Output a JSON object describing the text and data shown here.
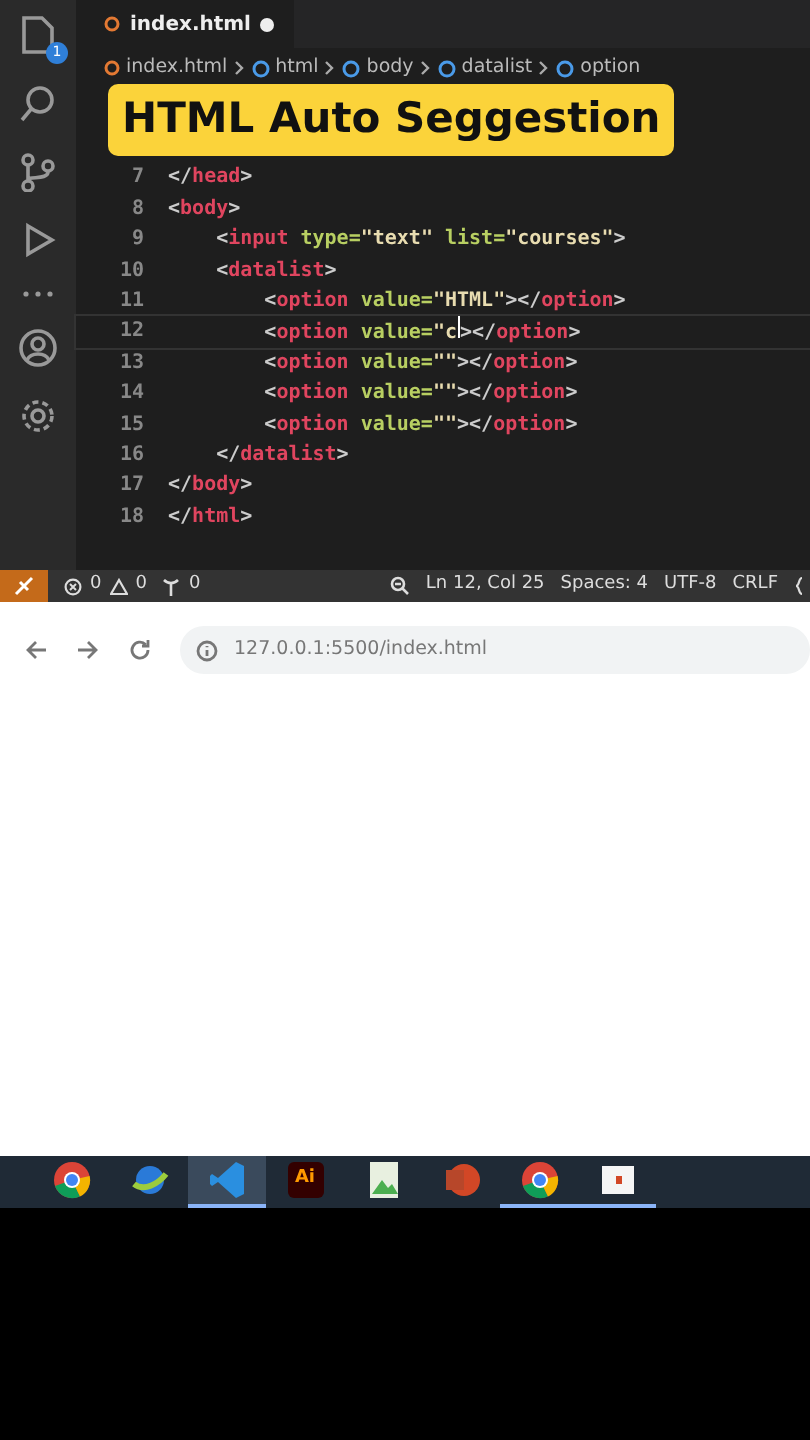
{
  "editor": {
    "tab": {
      "label": "index.html",
      "modified": true
    },
    "breadcrumbs": [
      "index.html",
      "html",
      "body",
      "datalist",
      "option"
    ],
    "overlay_title": "HTML Auto Seggestion",
    "activity_badge": "1",
    "lines": [
      {
        "number": "7",
        "current": false,
        "tokens": [
          {
            "kind": "punct",
            "text": "</"
          },
          {
            "kind": "tag",
            "text": "head"
          },
          {
            "kind": "punct",
            "text": ">"
          }
        ]
      },
      {
        "number": "8",
        "current": false,
        "tokens": [
          {
            "kind": "punct",
            "text": "<"
          },
          {
            "kind": "tag",
            "text": "body"
          },
          {
            "kind": "punct",
            "text": ">"
          }
        ]
      },
      {
        "number": "9",
        "current": false,
        "tokens": [
          {
            "kind": "punct",
            "text": "    <"
          },
          {
            "kind": "tag",
            "text": "input"
          },
          {
            "kind": "attr",
            "text": " type="
          },
          {
            "kind": "string",
            "text": "\"text\""
          },
          {
            "kind": "attr",
            "text": " list="
          },
          {
            "kind": "string",
            "text": "\"courses\""
          },
          {
            "kind": "punct",
            "text": ">"
          }
        ]
      },
      {
        "number": "10",
        "current": false,
        "tokens": [
          {
            "kind": "punct",
            "text": "    <"
          },
          {
            "kind": "tag",
            "text": "datalist"
          },
          {
            "kind": "punct",
            "text": ">"
          }
        ]
      },
      {
        "number": "11",
        "current": false,
        "tokens": [
          {
            "kind": "punct",
            "text": "        <"
          },
          {
            "kind": "tag",
            "text": "option"
          },
          {
            "kind": "attr",
            "text": " value="
          },
          {
            "kind": "string",
            "text": "\"HTML\""
          },
          {
            "kind": "punct",
            "text": "></"
          },
          {
            "kind": "tag",
            "text": "option"
          },
          {
            "kind": "punct",
            "text": ">"
          }
        ]
      },
      {
        "number": "12",
        "current": true,
        "tokens": [
          {
            "kind": "punct",
            "text": "        <"
          },
          {
            "kind": "tag",
            "text": "option"
          },
          {
            "kind": "attr",
            "text": " value="
          },
          {
            "kind": "string",
            "text": "\"c"
          },
          {
            "kind": "cursor"
          },
          {
            "kind": "punct",
            "text": "></"
          },
          {
            "kind": "tag",
            "text": "option"
          },
          {
            "kind": "punct",
            "text": ">"
          }
        ]
      },
      {
        "number": "13",
        "current": false,
        "tokens": [
          {
            "kind": "punct",
            "text": "        <"
          },
          {
            "kind": "tag",
            "text": "option"
          },
          {
            "kind": "attr",
            "text": " value="
          },
          {
            "kind": "string",
            "text": "\"\""
          },
          {
            "kind": "punct",
            "text": "></"
          },
          {
            "kind": "tag",
            "text": "option"
          },
          {
            "kind": "punct",
            "text": ">"
          }
        ]
      },
      {
        "number": "14",
        "current": false,
        "tokens": [
          {
            "kind": "punct",
            "text": "        <"
          },
          {
            "kind": "tag",
            "text": "option"
          },
          {
            "kind": "attr",
            "text": " value="
          },
          {
            "kind": "string",
            "text": "\"\""
          },
          {
            "kind": "punct",
            "text": "></"
          },
          {
            "kind": "tag",
            "text": "option"
          },
          {
            "kind": "punct",
            "text": ">"
          }
        ]
      },
      {
        "number": "15",
        "current": false,
        "tokens": [
          {
            "kind": "punct",
            "text": "        <"
          },
          {
            "kind": "tag",
            "text": "option"
          },
          {
            "kind": "attr",
            "text": " value="
          },
          {
            "kind": "string",
            "text": "\"\""
          },
          {
            "kind": "punct",
            "text": "></"
          },
          {
            "kind": "tag",
            "text": "option"
          },
          {
            "kind": "punct",
            "text": ">"
          }
        ]
      },
      {
        "number": "16",
        "current": false,
        "tokens": [
          {
            "kind": "punct",
            "text": "    </"
          },
          {
            "kind": "tag",
            "text": "datalist"
          },
          {
            "kind": "punct",
            "text": ">"
          }
        ]
      },
      {
        "number": "17",
        "current": false,
        "tokens": [
          {
            "kind": "punct",
            "text": "</"
          },
          {
            "kind": "tag",
            "text": "body"
          },
          {
            "kind": "punct",
            "text": ">"
          }
        ]
      },
      {
        "number": "18",
        "current": false,
        "tokens": [
          {
            "kind": "punct",
            "text": "</"
          },
          {
            "kind": "tag",
            "text": "html"
          },
          {
            "kind": "punct",
            "text": ">"
          }
        ]
      }
    ]
  },
  "status_bar": {
    "errors": "0",
    "warnings": "0",
    "ports": "0",
    "position": "Ln 12, Col 25",
    "spaces": "Spaces: 4",
    "encoding": "UTF-8",
    "eol": "CRLF"
  },
  "browser": {
    "url": "127.0.0.1:5500/index.html"
  },
  "taskbar": [
    {
      "kind": "chrome",
      "active": false
    },
    {
      "kind": "globe",
      "active": false
    },
    {
      "kind": "vscode",
      "active": true
    },
    {
      "kind": "illustrator",
      "label": "Ai",
      "active": false
    },
    {
      "kind": "image",
      "active": false
    },
    {
      "kind": "powerpoint",
      "active": false
    },
    {
      "kind": "chrome",
      "active": true
    },
    {
      "kind": "slides",
      "active": true
    }
  ]
}
